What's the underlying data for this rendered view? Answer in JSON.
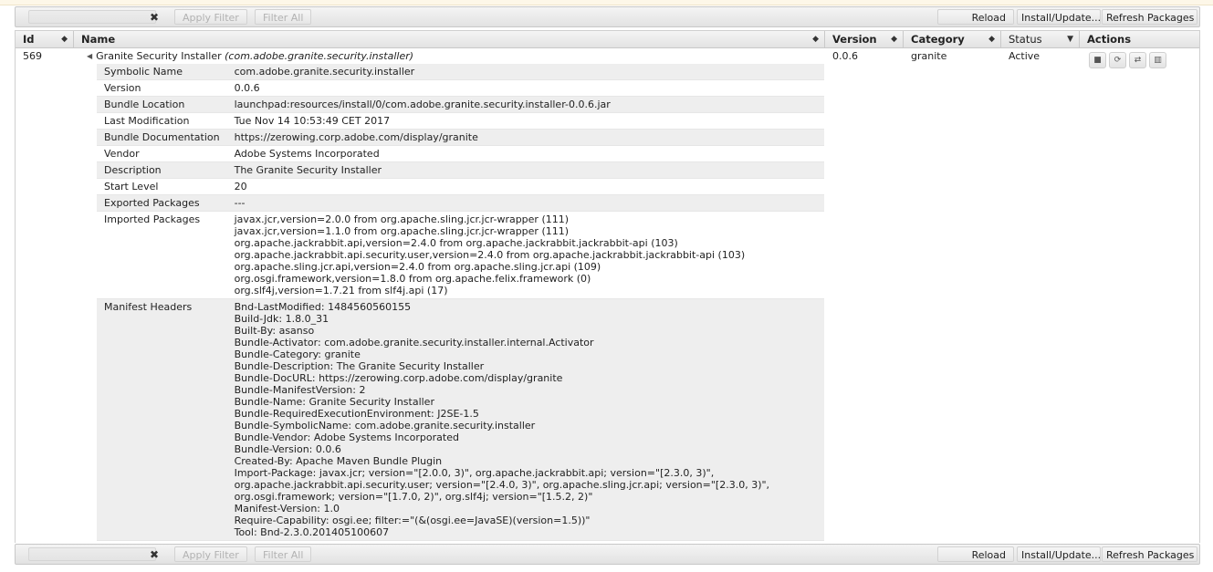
{
  "toolbar": {
    "filter_value": "",
    "apply_filter": "Apply Filter",
    "filter_all": "Filter All",
    "reload": "Reload",
    "install_update": "Install/Update...",
    "refresh_packages": "Refresh Packages"
  },
  "columns": {
    "id": "Id",
    "name": "Name",
    "version": "Version",
    "category": "Category",
    "status": "Status",
    "actions": "Actions"
  },
  "bundle": {
    "id": "569",
    "name": "Granite Security Installer",
    "symbolic": "(com.adobe.granite.security.installer)",
    "version": "0.0.6",
    "category": "granite",
    "status": "Active",
    "details": [
      {
        "key": "Symbolic Name",
        "value": "com.adobe.granite.security.installer"
      },
      {
        "key": "Version",
        "value": "0.0.6"
      },
      {
        "key": "Bundle Location",
        "value": "launchpad:resources/install/0/com.adobe.granite.security.installer-0.0.6.jar"
      },
      {
        "key": "Last Modification",
        "value": "Tue Nov 14 10:53:49 CET 2017"
      },
      {
        "key": "Bundle Documentation",
        "value": "https://zerowing.corp.adobe.com/display/granite"
      },
      {
        "key": "Vendor",
        "value": "Adobe Systems Incorporated"
      },
      {
        "key": "Description",
        "value": "The Granite Security Installer"
      },
      {
        "key": "Start Level",
        "value": "20"
      },
      {
        "key": "Exported Packages",
        "value": "---"
      }
    ],
    "imported_packages_label": "Imported Packages",
    "imported_packages": [
      "javax.jcr,version=2.0.0 from org.apache.sling.jcr.jcr-wrapper (111)",
      "javax.jcr,version=1.1.0 from org.apache.sling.jcr.jcr-wrapper (111)",
      "org.apache.jackrabbit.api,version=2.4.0 from org.apache.jackrabbit.jackrabbit-api (103)",
      "org.apache.jackrabbit.api.security.user,version=2.4.0 from org.apache.jackrabbit.jackrabbit-api (103)",
      "org.apache.sling.jcr.api,version=2.4.0 from org.apache.sling.jcr.api (109)",
      "org.osgi.framework,version=1.8.0 from org.apache.felix.framework (0)",
      "org.slf4j,version=1.7.21 from slf4j.api (17)"
    ],
    "manifest_headers_label": "Manifest Headers",
    "manifest_headers": [
      "Bnd-LastModified: 1484560560155",
      "Build-Jdk: 1.8.0_31",
      "Built-By: asanso",
      "Bundle-Activator: com.adobe.granite.security.installer.internal.Activator",
      "Bundle-Category: granite",
      "Bundle-Description: The Granite Security Installer",
      "Bundle-DocURL: https://zerowing.corp.adobe.com/display/granite",
      "Bundle-ManifestVersion: 2",
      "Bundle-Name: Granite Security Installer",
      "Bundle-RequiredExecutionEnvironment: J2SE-1.5",
      "Bundle-SymbolicName: com.adobe.granite.security.installer",
      "Bundle-Vendor: Adobe Systems Incorporated",
      "Bundle-Version: 0.0.6",
      "Created-By: Apache Maven Bundle Plugin",
      "Import-Package: javax.jcr; version=\"[2.0.0, 3)\", org.apache.jackrabbit.api; version=\"[2.3.0, 3)\",",
      "org.apache.jackrabbit.api.security.user; version=\"[2.4.0, 3)\", org.apache.sling.jcr.api; version=\"[2.3.0, 3)\",",
      "org.osgi.framework; version=\"[1.7.0, 2)\", org.slf4j; version=\"[1.5.2, 2)\"",
      "Manifest-Version: 1.0",
      "Require-Capability: osgi.ee; filter:=\"(&(osgi.ee=JavaSE)(version=1.5))\"",
      "Tool: Bnd-2.3.0.201405100607"
    ]
  },
  "icons": {
    "clear": "×",
    "expander": "◂",
    "sort": "⬍",
    "sort_desc": "▼",
    "stop": "■",
    "refresh": "⟳",
    "update": "⇄",
    "uninstall": "🗑"
  }
}
